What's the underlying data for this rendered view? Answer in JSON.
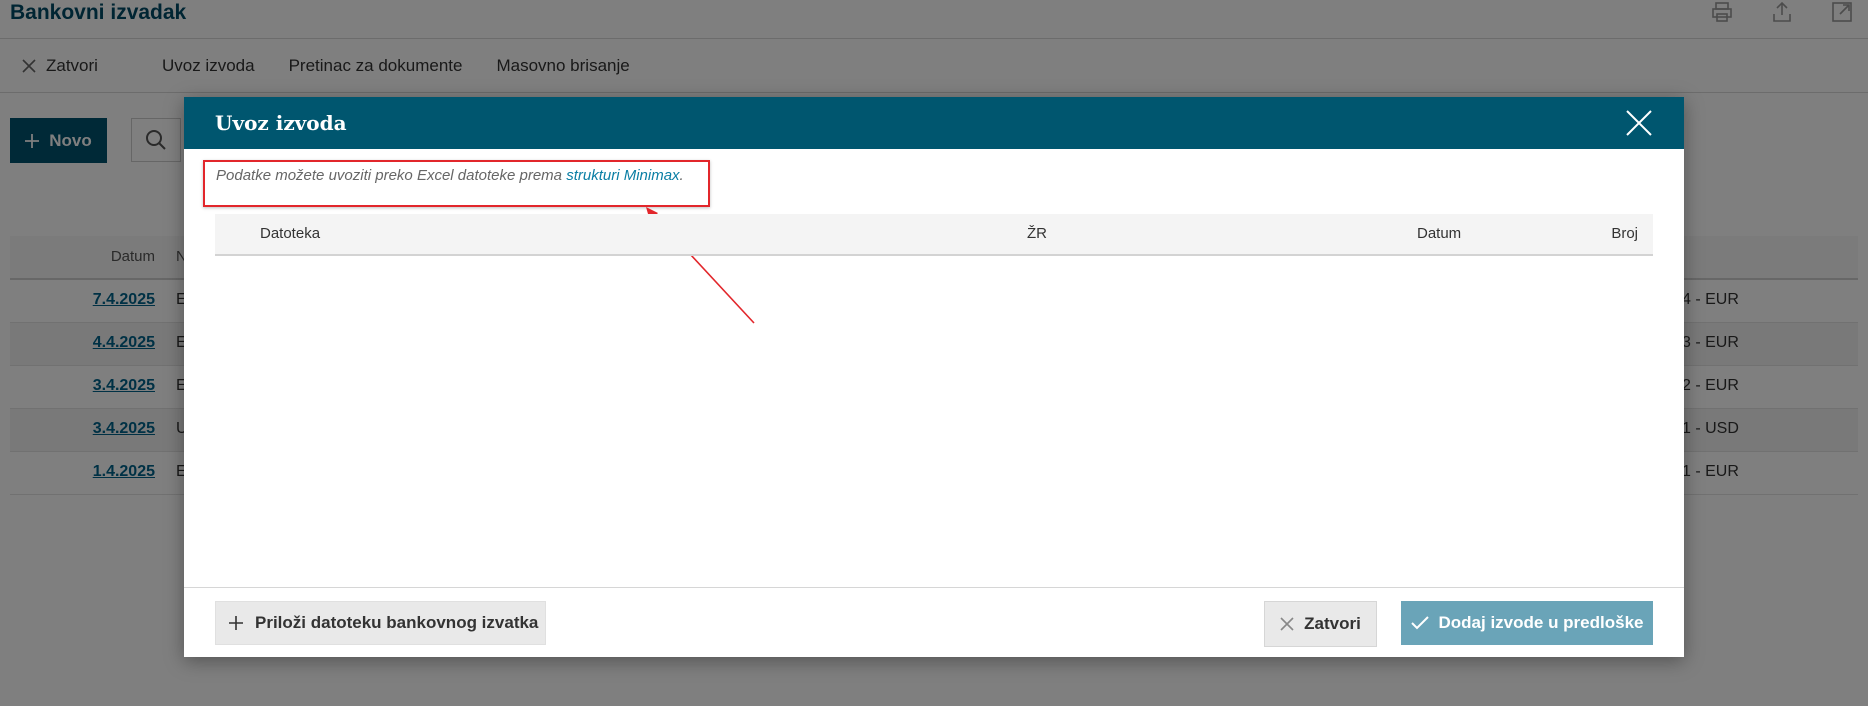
{
  "page": {
    "title": "Bankovni izvadak",
    "icons": [
      "print-icon",
      "share-icon",
      "external-link-icon"
    ]
  },
  "toolbar": {
    "close_label": "Zatvori",
    "import_label": "Uvoz izvoda",
    "inbox_label": "Pretinac za dokumente",
    "mass_delete_label": "Masovno brisanje"
  },
  "actions": {
    "new_label": "Novo"
  },
  "table": {
    "header_date": "Datum",
    "header_second": "N",
    "rows": [
      {
        "date": "7.4.2025",
        "code": "E",
        "currency": "4 - EUR"
      },
      {
        "date": "4.4.2025",
        "code": "E",
        "currency": "3 - EUR"
      },
      {
        "date": "3.4.2025",
        "code": "E",
        "currency": "2 - EUR"
      },
      {
        "date": "3.4.2025",
        "code": "U",
        "currency": "1 - USD"
      },
      {
        "date": "1.4.2025",
        "code": "E",
        "currency": "1 - EUR"
      }
    ]
  },
  "modal": {
    "title": "Uvoz izvoda",
    "notice_text": "Podatke možete uvoziti preko Excel datoteke prema ",
    "notice_link": "strukturi Minimax",
    "notice_end": ".",
    "columns": {
      "file": "Datoteka",
      "account": "ŽR",
      "date": "Datum",
      "number": "Broj"
    },
    "attach_label": "Priloži datoteku bankovnog izvatka",
    "close_label": "Zatvori",
    "confirm_label": "Dodaj izvode u predloške"
  },
  "colors": {
    "brand": "#00566f",
    "link": "#0a7ea4",
    "confirm_disabled": "#6aa4b8",
    "callout": "#e2262b"
  }
}
